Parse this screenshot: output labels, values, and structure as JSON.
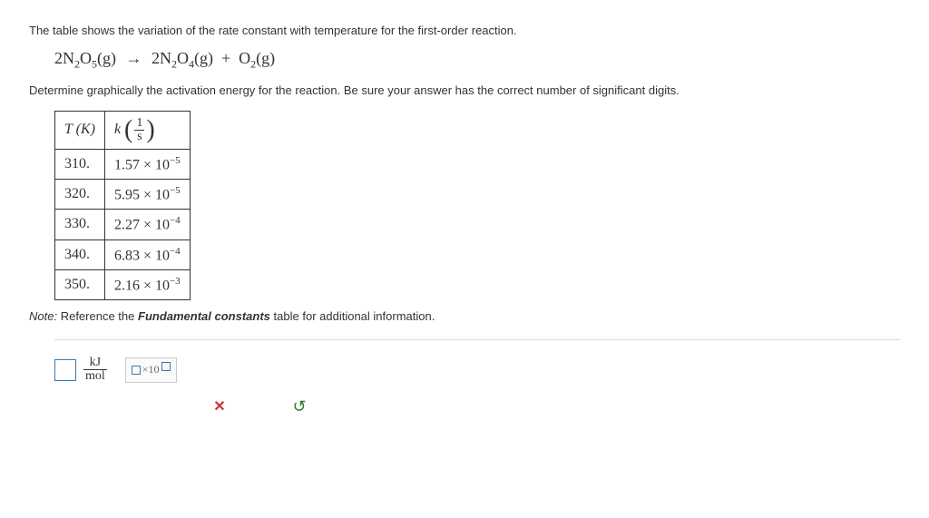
{
  "intro": "The table shows the variation of the rate constant with temperature for the first-order reaction.",
  "equation": {
    "lhs_coef": "2",
    "lhs_species": "N",
    "lhs_sub1": "2",
    "lhs_mid": "O",
    "lhs_sub2": "5",
    "phase": "(g)",
    "arrow": "→",
    "rhs1_coef": "2",
    "rhs1_species": "N",
    "rhs1_sub1": "2",
    "rhs1_mid": "O",
    "rhs1_sub2": "4",
    "plus": "+",
    "rhs2_species": "O",
    "rhs2_sub": "2"
  },
  "instruction": "Determine graphically the activation energy for the reaction. Be sure your answer has the correct number of significant digits.",
  "table": {
    "header_T": "T (K)",
    "header_k_prefix": "k",
    "frac_num": "1",
    "frac_den": "s",
    "rows": [
      {
        "T": "310.",
        "k_base": "1.57 × 10",
        "k_exp": "−5"
      },
      {
        "T": "320.",
        "k_base": "5.95 × 10",
        "k_exp": "−5"
      },
      {
        "T": "330.",
        "k_base": "2.27 × 10",
        "k_exp": "−4"
      },
      {
        "T": "340.",
        "k_base": "6.83 × 10",
        "k_exp": "−4"
      },
      {
        "T": "350.",
        "k_base": "2.16 × 10",
        "k_exp": "−3"
      }
    ]
  },
  "note": {
    "label": "Note:",
    "prefix": "Reference the",
    "term": "Fundamental constants",
    "suffix": "table for additional information."
  },
  "answer": {
    "unit_num": "kJ",
    "unit_den": "mol",
    "sci_label": "×10"
  }
}
